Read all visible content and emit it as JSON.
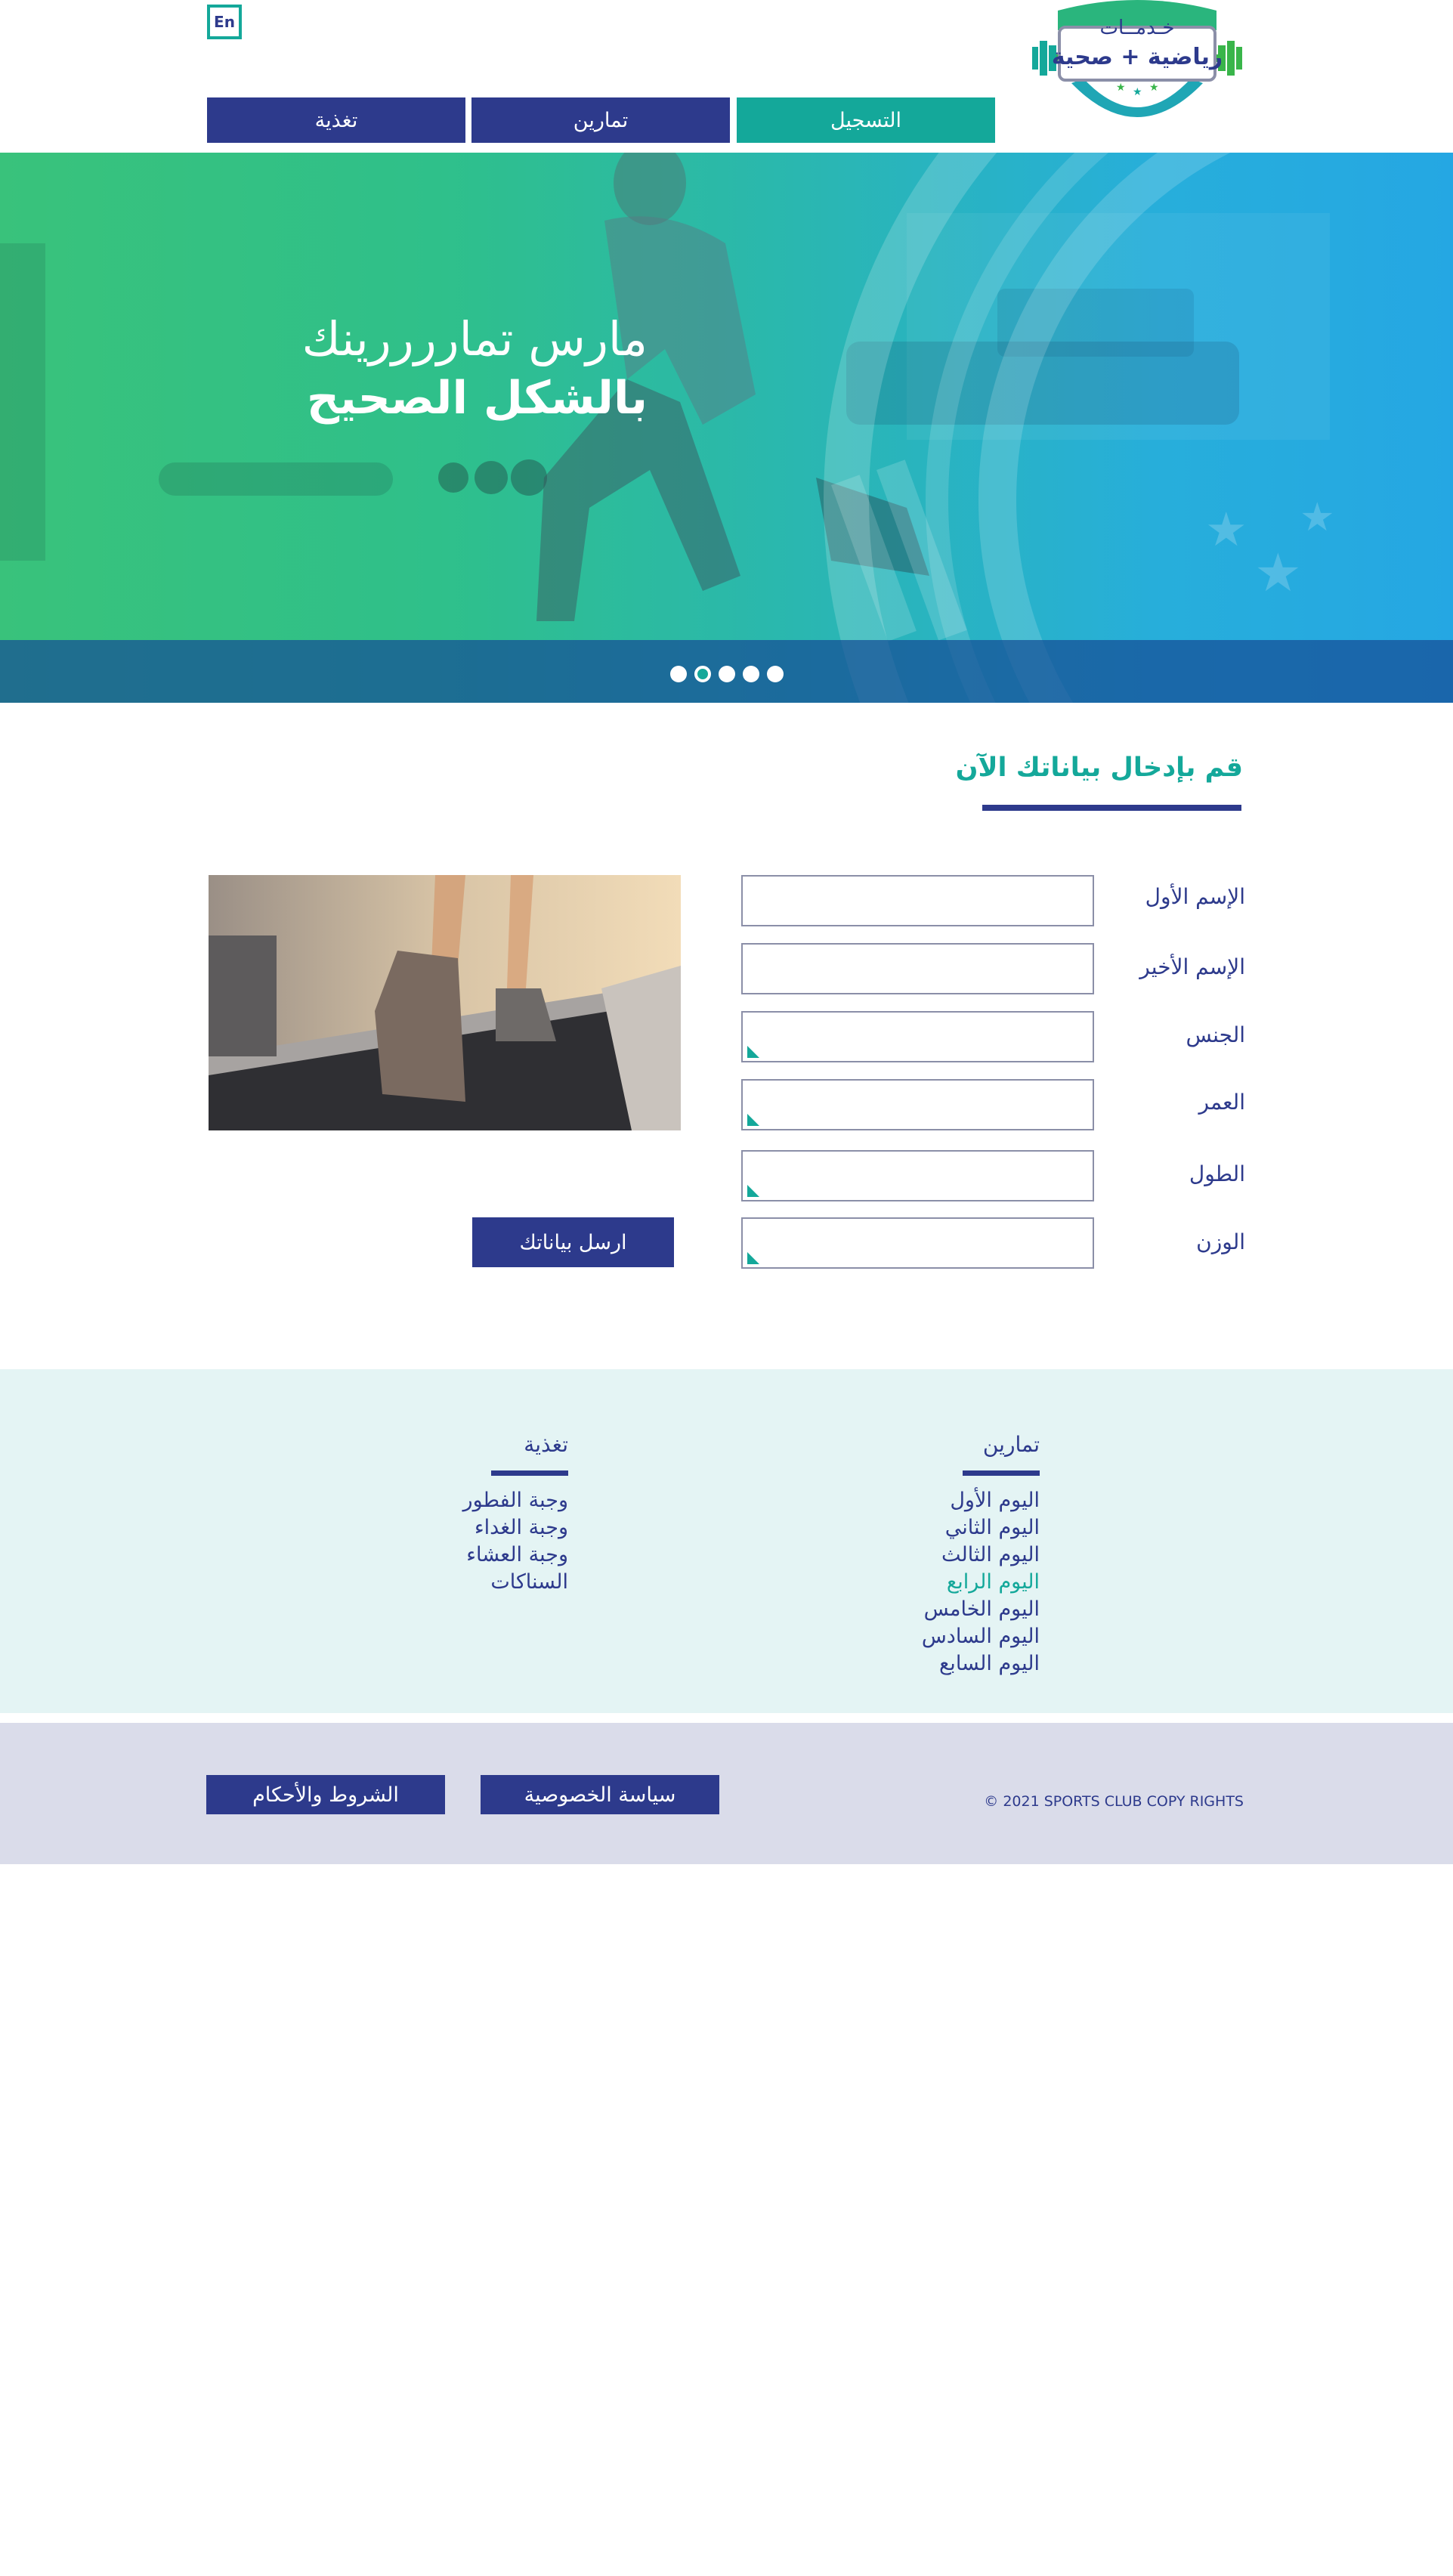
{
  "header": {
    "lang_button": "En",
    "logo": {
      "line1": "خـدمــات",
      "line2": "رياضية + صحية"
    },
    "nav": [
      "التسجيل",
      "تمارين",
      "تغذية"
    ]
  },
  "hero": {
    "line1": "مارس تماررررينك",
    "line2": "بالشكل الصحيح",
    "slide_count": 5,
    "active_slide": 2
  },
  "form": {
    "title": "قم  بإدخال بياناتك الآن",
    "fields": [
      {
        "label": "الإسم الأول",
        "kind": "text"
      },
      {
        "label": "الإسم الأخير",
        "kind": "text"
      },
      {
        "label": "الجنس",
        "kind": "select"
      },
      {
        "label": "العمر",
        "kind": "select"
      },
      {
        "label": "الطول",
        "kind": "select"
      },
      {
        "label": "الوزن",
        "kind": "select"
      }
    ],
    "submit": "ارسل بياناتك"
  },
  "footer_links": {
    "exercises": {
      "title": "تمارين",
      "items": [
        "اليوم الأول",
        "اليوم الثاني",
        "اليوم الثالث",
        "اليوم الرابع",
        "اليوم الخامس",
        "اليوم السادس",
        "اليوم السابع"
      ],
      "highlighted_index": 3
    },
    "nutrition": {
      "title": "تغذية",
      "items": [
        "وجبة الفطور",
        "وجبة الغداء",
        "وجبة العشاء",
        "السناكات"
      ]
    }
  },
  "footer_bar": {
    "privacy": "سياسة الخصوصية",
    "terms": "الشروط والأحكام",
    "copyright": "© 2021 SPORTS CLUB COPY RIGHTS"
  },
  "colors": {
    "teal": "#14a89a",
    "navy": "#2d3a8c",
    "light_teal_bg": "#e4f4f4",
    "lavender_bg": "#dadcea"
  }
}
